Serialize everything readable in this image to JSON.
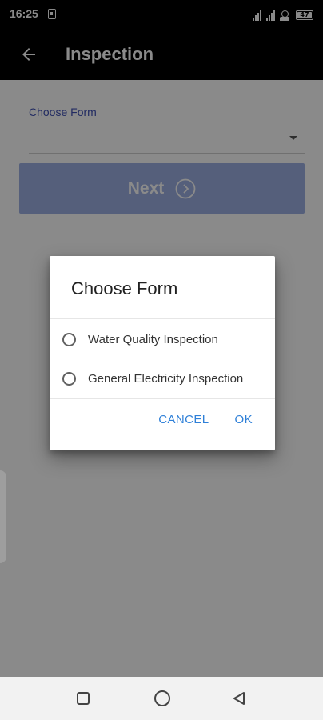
{
  "status_bar": {
    "time": "16:25",
    "battery_level": "47",
    "icons": [
      "sim-card-icon",
      "signal-icon",
      "network-icon",
      "battery-icon"
    ]
  },
  "app_bar": {
    "title": "Inspection",
    "back_icon": "arrow-left-icon"
  },
  "form": {
    "label": "Choose Form",
    "selected_value": "",
    "next_label": "Next",
    "next_icon": "chevron-right-circle-icon"
  },
  "dialog": {
    "title": "Choose Form",
    "options": [
      {
        "label": "Water Quality Inspection",
        "selected": false
      },
      {
        "label": "General Electricity Inspection",
        "selected": false
      }
    ],
    "cancel_label": "CANCEL",
    "ok_label": "OK"
  },
  "nav_bar": {
    "icons": [
      "recents-square-icon",
      "home-circle-icon",
      "back-triangle-icon"
    ]
  },
  "colors": {
    "accent": "#3f51b5",
    "button_disabled": "#9db0e3",
    "dialog_action": "#2f80d8",
    "app_bar": "#000000"
  }
}
